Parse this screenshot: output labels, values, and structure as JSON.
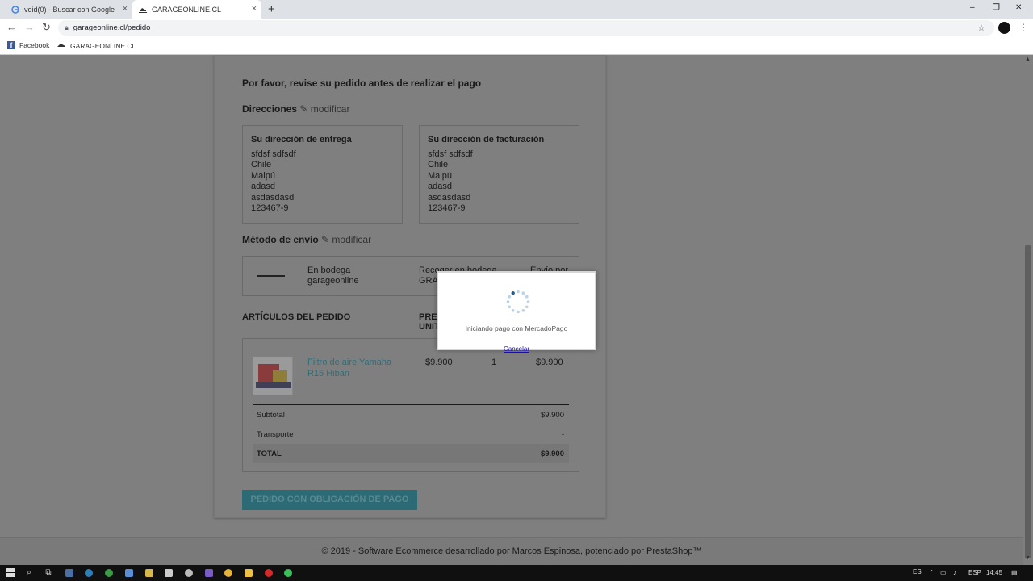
{
  "browser": {
    "tabs": [
      {
        "label": "void(0) - Buscar con Google",
        "close": "×"
      },
      {
        "label": "GARAGEONLINE.CL",
        "close": "×"
      }
    ],
    "new_tab": "+",
    "window_controls": {
      "minimize": "–",
      "restore": "❐",
      "close": "✕"
    },
    "url": "garageonline.cl/pedido",
    "bookmarks": [
      {
        "label": "Facebook"
      },
      {
        "label": "GARAGEONLINE.CL"
      }
    ]
  },
  "page": {
    "title": "Por favor, revise su pedido antes de realizar el pago",
    "addresses": {
      "heading": "Direcciones",
      "modify": "modificar",
      "delivery": {
        "title": "Su dirección de entrega",
        "lines": [
          "sfdsf sdfsdf",
          "Chile",
          "Maipú",
          "adasd",
          "asdasdasd",
          "123467-9"
        ]
      },
      "billing": {
        "title": "Su dirección de facturación",
        "lines": [
          "sfdsf sdfsdf",
          "Chile",
          "Maipú",
          "adasd",
          "asdasdasd",
          "123467-9"
        ]
      }
    },
    "shipping": {
      "heading": "Método de envío",
      "modify": "modificar",
      "name_line1": "En bodega",
      "name_line2": "garageonline",
      "desc_line1": "Recoger en bodega",
      "desc_line2": "GRATIS",
      "extra_line1": "Envío por"
    },
    "items": {
      "heading": "ARTÍCULOS DEL PEDIDO",
      "price_header_line1": "PRECIO",
      "price_header_line2": "UNITARIO",
      "rows": [
        {
          "name_line1": "Filtro de aire Yamaha",
          "name_line2": "R15 Hibari",
          "unit_price": "$9.900",
          "qty": "1",
          "total": "$9.900"
        }
      ],
      "subtotal_label": "Subtotal",
      "subtotal_value": "$9.900",
      "transport_label": "Transporte",
      "transport_value": "-",
      "total_label": "TOTAL",
      "total_value": "$9.900"
    },
    "order_button": "PEDIDO CON OBLIGACIÓN DE PAGO",
    "footer": "© 2019 - Software Ecommerce desarrollado por Marcos Espinosa, potenciado por PrestaShop™"
  },
  "modal": {
    "message": "Iniciando pago con MercadoPago",
    "cancel": "Cancelar"
  },
  "taskbar": {
    "lang": "ES",
    "keyboard": "ESP",
    "time": "14:45"
  },
  "colors": {
    "overlay": "#7f7f7f",
    "button": "#2c6b76",
    "product_link": "#2f6f7a",
    "taskbar": "#101010"
  }
}
